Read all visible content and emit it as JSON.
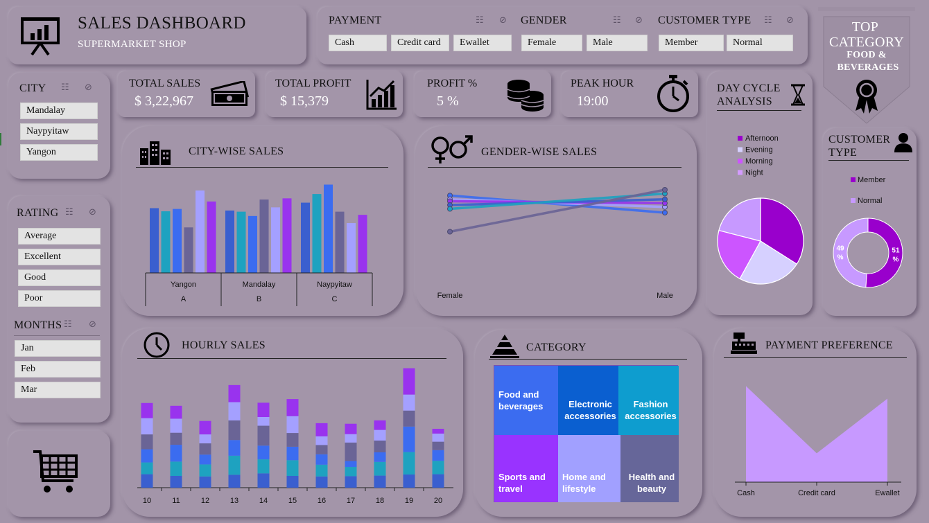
{
  "header": {
    "title": "SALES DASHBOARD",
    "subtitle": "SUPERMARKET SHOP"
  },
  "payment_filter": {
    "label": "PAYMENT",
    "options": [
      "Cash",
      "Credit card",
      "Ewallet"
    ]
  },
  "gender_filter": {
    "label": "GENDER",
    "options": [
      "Female",
      "Male"
    ]
  },
  "customer_type_filter": {
    "label": "CUSTOMER TYPE",
    "options": [
      "Member",
      "Normal"
    ]
  },
  "top_category": {
    "line1": "TOP",
    "line2": "CATEGORY",
    "value1": "FOOD &",
    "value2": "BEVERAGES"
  },
  "city_filter": {
    "label": "CITY",
    "options": [
      "Mandalay",
      "Naypyitaw",
      "Yangon"
    ]
  },
  "rating_filter": {
    "label": "RATING",
    "options": [
      "Average",
      "Excellent",
      "Good",
      "Poor"
    ]
  },
  "months_filter": {
    "label": "MONTHS",
    "options": [
      "Jan",
      "Feb",
      "Mar"
    ]
  },
  "kpis": {
    "total_sales": {
      "label": "TOTAL SALES",
      "value": "$ 3,22,967"
    },
    "total_profit": {
      "label": "TOTAL PROFIT",
      "value": "$ 15,379"
    },
    "profit_pct": {
      "label": "PROFIT %",
      "value": "5 %"
    },
    "peak_hour": {
      "label": "PEAK HOUR",
      "value": "19:00"
    }
  },
  "day_cycle": {
    "title1": "DAY CYCLE",
    "title2": "ANALYSIS"
  },
  "customer_type_panel": {
    "title1": "CUSTOMER",
    "title2": "TYPE"
  },
  "city_sales": {
    "title": "CITY-WISE SALES"
  },
  "gender_sales": {
    "title": "GENDER-WISE SALES"
  },
  "hourly_sales": {
    "title": "HOURLY SALES"
  },
  "category": {
    "title": "CATEGORY"
  },
  "payment_pref": {
    "title": "PAYMENT PREFERENCE"
  },
  "colors": {
    "c1": "#3a5fcf",
    "c2": "#1ea2c0",
    "c3": "#3b6cf0",
    "c4": "#6a6496",
    "c5": "#a4a0ff",
    "c6": "#9933ee",
    "purple": "#9900cc",
    "lavender": "#c799ff"
  },
  "chart_data": [
    {
      "type": "bar",
      "title": "CITY-WISE SALES",
      "categories": [
        {
          "city": "Yangon",
          "branch": "A"
        },
        {
          "city": "Mandalay",
          "branch": "B"
        },
        {
          "city": "Naypyitaw",
          "branch": "C"
        }
      ],
      "series_values": [
        [
          16500,
          15700,
          16300,
          11600,
          21000,
          18200
        ],
        [
          15900,
          15600,
          14500,
          18700,
          16700,
          19000
        ],
        [
          17900,
          20100,
          22500,
          15600,
          12700,
          14800
        ]
      ],
      "ylim": [
        0,
        24000
      ]
    },
    {
      "type": "line",
      "title": "GENDER-WISE SALES",
      "x": [
        "Female",
        "Male"
      ],
      "series": [
        {
          "values": [
            58,
            40
          ]
        },
        {
          "values": [
            54,
            46
          ]
        },
        {
          "values": [
            52,
            50
          ]
        },
        {
          "values": [
            48,
            54
          ]
        },
        {
          "values": [
            44,
            60
          ]
        },
        {
          "values": [
            20,
            64
          ]
        }
      ],
      "ylim": [
        0,
        80
      ]
    },
    {
      "type": "bar",
      "title": "HOURLY SALES",
      "stacked": true,
      "categories": [
        "10",
        "11",
        "12",
        "13",
        "14",
        "15",
        "16",
        "17",
        "18",
        "19",
        "20"
      ],
      "stacks": [
        [
          4800,
          4200,
          4700,
          5300,
          5800,
          5400
        ],
        [
          4200,
          5100,
          6000,
          4300,
          5000,
          4600
        ],
        [
          4000,
          4300,
          3500,
          4000,
          3200,
          4800
        ],
        [
          4600,
          6800,
          5600,
          7000,
          6500,
          6100
        ],
        [
          5100,
          5000,
          4900,
          7100,
          3100,
          5100
        ],
        [
          4200,
          5600,
          4800,
          4900,
          6000,
          6100
        ],
        [
          4000,
          4200,
          3700,
          3300,
          3100,
          4700
        ],
        [
          4100,
          3300,
          2100,
          6600,
          3000,
          3700
        ],
        [
          4300,
          4900,
          3400,
          4200,
          3800,
          3400
        ],
        [
          4700,
          8000,
          9100,
          5700,
          5700,
          9400
        ],
        [
          4800,
          4800,
          3800,
          3000,
          2900,
          1700
        ]
      ],
      "ylim": [
        0,
        42000
      ]
    },
    {
      "type": "pie",
      "title": "DAY CYCLE ANALYSIS",
      "labels": [
        "Afternoon",
        "Evening",
        "Morning",
        "Night"
      ],
      "values": [
        34,
        24,
        21,
        21
      ]
    },
    {
      "type": "pie",
      "title": "CUSTOMER TYPE",
      "labels": [
        "Member",
        "Normal"
      ],
      "values": [
        51,
        49
      ],
      "data_labels": [
        "51 %",
        "49 %"
      ]
    },
    {
      "type": "heatmap",
      "title": "CATEGORY",
      "labels": [
        "Food and beverages",
        "Electronic accessories",
        "Fashion accessories",
        "Sports and travel",
        "Home and lifestyle",
        "Health and beauty"
      ]
    },
    {
      "type": "area",
      "title": "PAYMENT PREFERENCE",
      "categories": [
        "Cash",
        "Credit card",
        "Ewallet"
      ],
      "values": [
        112000,
        100800,
        109900
      ],
      "ylim": [
        96000,
        114000
      ]
    }
  ]
}
